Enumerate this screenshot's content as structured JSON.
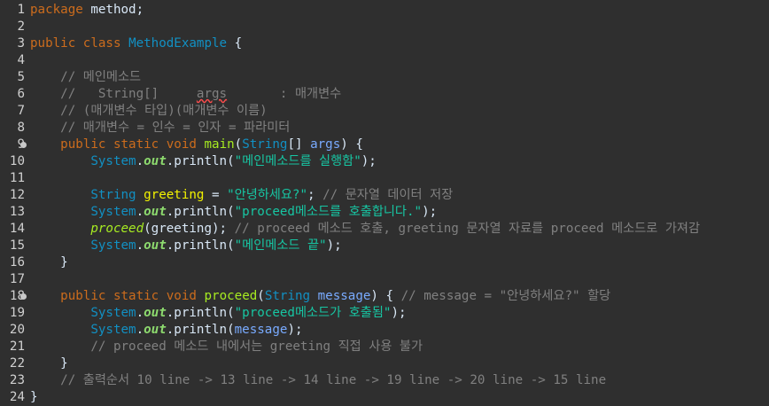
{
  "editor": {
    "lines": [
      {
        "n": "1",
        "tokens": [
          {
            "t": "package",
            "c": "kw"
          },
          {
            "t": " method;",
            "c": "plain"
          }
        ]
      },
      {
        "n": "2",
        "tokens": []
      },
      {
        "n": "3",
        "tokens": [
          {
            "t": "public",
            "c": "kw"
          },
          {
            "t": " ",
            "c": "plain"
          },
          {
            "t": "class",
            "c": "kw"
          },
          {
            "t": " ",
            "c": "plain"
          },
          {
            "t": "MethodExample",
            "c": "type"
          },
          {
            "t": " {",
            "c": "plain"
          }
        ]
      },
      {
        "n": "4",
        "tokens": []
      },
      {
        "n": "5",
        "tokens": [
          {
            "t": "    // 메인메소드",
            "c": "cmt"
          }
        ]
      },
      {
        "n": "6",
        "tokens": [
          {
            "t": "    //   String[]     ",
            "c": "cmt"
          },
          {
            "t": "args",
            "c": "cmt-sq"
          },
          {
            "t": "       : 매개변수",
            "c": "cmt"
          }
        ]
      },
      {
        "n": "7",
        "tokens": [
          {
            "t": "    // (매개변수 타입)(매개변수 이름)",
            "c": "cmt"
          }
        ]
      },
      {
        "n": "8",
        "tokens": [
          {
            "t": "    // 매개변수 = 인수 = 인자 = 파라미터",
            "c": "cmt"
          }
        ]
      },
      {
        "n": "9",
        "fold": true,
        "tokens": [
          {
            "t": "    ",
            "c": "plain"
          },
          {
            "t": "public",
            "c": "kw"
          },
          {
            "t": " ",
            "c": "plain"
          },
          {
            "t": "static",
            "c": "kw"
          },
          {
            "t": " ",
            "c": "plain"
          },
          {
            "t": "void",
            "c": "kw"
          },
          {
            "t": " ",
            "c": "plain"
          },
          {
            "t": "main",
            "c": "method"
          },
          {
            "t": "(",
            "c": "plain"
          },
          {
            "t": "String",
            "c": "type"
          },
          {
            "t": "[] ",
            "c": "plain"
          },
          {
            "t": "args",
            "c": "param"
          },
          {
            "t": ") {",
            "c": "plain"
          }
        ]
      },
      {
        "n": "10",
        "tokens": [
          {
            "t": "        ",
            "c": "plain"
          },
          {
            "t": "System",
            "c": "type"
          },
          {
            "t": ".",
            "c": "plain"
          },
          {
            "t": "out",
            "c": "field"
          },
          {
            "t": ".println(",
            "c": "plain"
          },
          {
            "t": "\"메인메소드를 실행함\"",
            "c": "str"
          },
          {
            "t": ");",
            "c": "plain"
          }
        ]
      },
      {
        "n": "11",
        "tokens": []
      },
      {
        "n": "12",
        "tokens": [
          {
            "t": "        ",
            "c": "plain"
          },
          {
            "t": "String",
            "c": "type"
          },
          {
            "t": " ",
            "c": "plain"
          },
          {
            "t": "greeting",
            "c": "local"
          },
          {
            "t": " = ",
            "c": "plain"
          },
          {
            "t": "\"안녕하세요?\"",
            "c": "str"
          },
          {
            "t": "; ",
            "c": "plain"
          },
          {
            "t": "// 문자열 데이터 저장",
            "c": "cmt"
          }
        ]
      },
      {
        "n": "13",
        "tokens": [
          {
            "t": "        ",
            "c": "plain"
          },
          {
            "t": "System",
            "c": "type"
          },
          {
            "t": ".",
            "c": "plain"
          },
          {
            "t": "out",
            "c": "field"
          },
          {
            "t": ".println(",
            "c": "plain"
          },
          {
            "t": "\"proceed메소드를 호출합니다.\"",
            "c": "str"
          },
          {
            "t": ");",
            "c": "plain"
          }
        ]
      },
      {
        "n": "14",
        "tokens": [
          {
            "t": "        ",
            "c": "plain"
          },
          {
            "t": "proceed",
            "c": "imethod"
          },
          {
            "t": "(greeting); ",
            "c": "plain"
          },
          {
            "t": "// proceed 메소드 호출, greeting 문자열 자료를 proceed 메소드로 가져감",
            "c": "cmt"
          }
        ]
      },
      {
        "n": "15",
        "tokens": [
          {
            "t": "        ",
            "c": "plain"
          },
          {
            "t": "System",
            "c": "type"
          },
          {
            "t": ".",
            "c": "plain"
          },
          {
            "t": "out",
            "c": "field"
          },
          {
            "t": ".println(",
            "c": "plain"
          },
          {
            "t": "\"메인메소드 끝\"",
            "c": "str"
          },
          {
            "t": ");",
            "c": "plain"
          }
        ]
      },
      {
        "n": "16",
        "tokens": [
          {
            "t": "    }",
            "c": "plain"
          }
        ]
      },
      {
        "n": "17",
        "tokens": []
      },
      {
        "n": "18",
        "fold": true,
        "tokens": [
          {
            "t": "    ",
            "c": "plain"
          },
          {
            "t": "public",
            "c": "kw"
          },
          {
            "t": " ",
            "c": "plain"
          },
          {
            "t": "static",
            "c": "kw"
          },
          {
            "t": " ",
            "c": "plain"
          },
          {
            "t": "void",
            "c": "kw"
          },
          {
            "t": " ",
            "c": "plain"
          },
          {
            "t": "proceed",
            "c": "method"
          },
          {
            "t": "(",
            "c": "plain"
          },
          {
            "t": "String",
            "c": "type"
          },
          {
            "t": " ",
            "c": "plain"
          },
          {
            "t": "message",
            "c": "param"
          },
          {
            "t": ") { ",
            "c": "plain"
          },
          {
            "t": "// message = \"안녕하세요?\" 할당",
            "c": "cmt"
          }
        ]
      },
      {
        "n": "19",
        "tokens": [
          {
            "t": "        ",
            "c": "plain"
          },
          {
            "t": "System",
            "c": "type"
          },
          {
            "t": ".",
            "c": "plain"
          },
          {
            "t": "out",
            "c": "field"
          },
          {
            "t": ".println(",
            "c": "plain"
          },
          {
            "t": "\"proceed메소드가 호출됨\"",
            "c": "str"
          },
          {
            "t": ");",
            "c": "plain"
          }
        ]
      },
      {
        "n": "20",
        "tokens": [
          {
            "t": "        ",
            "c": "plain"
          },
          {
            "t": "System",
            "c": "type"
          },
          {
            "t": ".",
            "c": "plain"
          },
          {
            "t": "out",
            "c": "field"
          },
          {
            "t": ".println(",
            "c": "plain"
          },
          {
            "t": "message",
            "c": "param"
          },
          {
            "t": ");",
            "c": "plain"
          }
        ]
      },
      {
        "n": "21",
        "tokens": [
          {
            "t": "        // proceed 메소드 내에서는 greeting 직접 사용 불가",
            "c": "cmt"
          }
        ]
      },
      {
        "n": "22",
        "tokens": [
          {
            "t": "    }",
            "c": "plain"
          }
        ]
      },
      {
        "n": "23",
        "tokens": [
          {
            "t": "    // 출력순서 10 line -> 13 line -> 14 line -> 19 line -> 20 line -> 15 line",
            "c": "cmt"
          }
        ]
      },
      {
        "n": "24",
        "tokens": [
          {
            "t": "}",
            "c": "plain"
          }
        ]
      }
    ]
  }
}
